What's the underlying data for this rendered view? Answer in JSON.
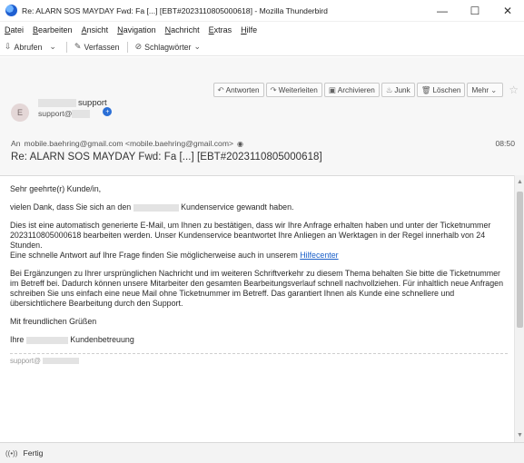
{
  "window": {
    "title": "Re: ALARN SOS MAYDAY Fwd: Fa [...] [EBT#2023110805000618] - Mozilla Thunderbird",
    "minimize": "—",
    "maximize": "☐",
    "close": "✕"
  },
  "menu": [
    "Datei",
    "Bearbeiten",
    "Ansicht",
    "Navigation",
    "Nachricht",
    "Extras",
    "Hilfe"
  ],
  "toolbar": {
    "get_mail": "Abrufen",
    "compose": "Verfassen",
    "tags": "Schlagwörter"
  },
  "header": {
    "actions": {
      "reply": "Antworten",
      "forward": "Weiterleiten",
      "archive": "Archivieren",
      "junk": "Junk",
      "delete": "Löschen",
      "more": "Mehr"
    },
    "avatar_letter": "E",
    "sender_name": "support",
    "sender_email": "support@",
    "to_label": "An",
    "to_value": "mobile.baehring@gmail.com <mobile.baehring@gmail.com>",
    "time": "08:50",
    "subject": "Re: ALARN SOS MAYDAY Fwd: Fa [...] [EBT#2023110805000618]"
  },
  "body": {
    "greeting": "Sehr geehrte(r) Kunde/in,",
    "thanks_pre": "vielen Dank, dass Sie sich an den",
    "thanks_post": "Kundenservice gewandt haben.",
    "para1": "Dies ist eine automatisch generierte E-Mail, um Ihnen zu bestätigen, dass wir Ihre Anfrage erhalten haben und unter der Ticketnummer 2023110805000618 bearbeiten werden. Unser Kundenservice beantwortet Ihre Anliegen an Werktagen in der Regel innerhalb von 24 Stunden.",
    "para1_link_pre": "Eine schnelle Antwort auf Ihre Frage finden Sie möglicherweise auch in unserem",
    "para1_link": "Hilfecenter",
    "para2": "Bei Ergänzungen zu Ihrer ursprünglichen Nachricht und im weiteren Schriftverkehr zu diesem Thema behalten Sie bitte die Ticketnummer im Betreff bei. Dadurch können unsere Mitarbeiter den gesamten Bearbeitungsverlauf schnell nachvollziehen. Für inhaltlich neue Anfragen schreiben Sie uns einfach eine neue Mail ohne Ticketnummer im Betreff. Das garantiert Ihnen als Kunde eine schnellere und übersichtlichere Bearbeitung durch den Support.",
    "closing": "Mit freundlichen Grüßen",
    "sign_pre": "Ihre",
    "sign_post": "Kundenbetreuung",
    "footer": "support@"
  },
  "status": {
    "text": "Fertig"
  }
}
